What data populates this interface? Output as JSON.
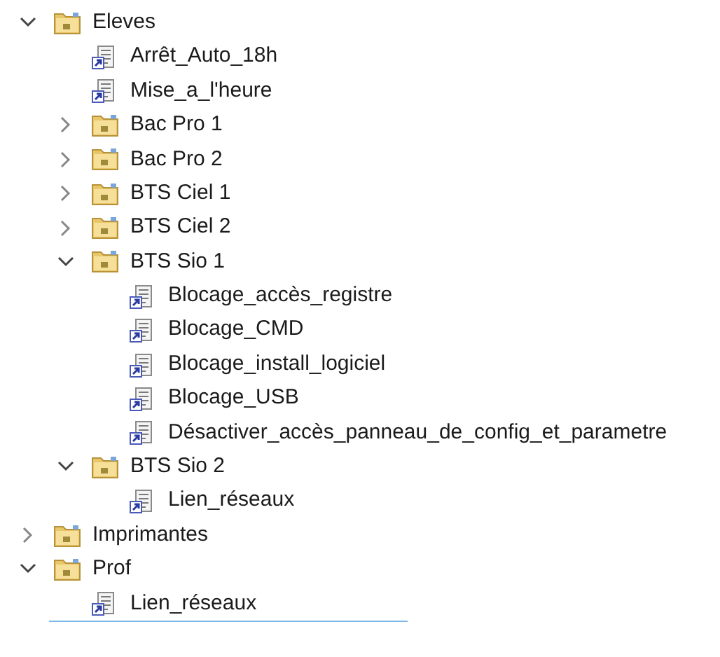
{
  "tree": [
    {
      "label": "Eleves",
      "kind": "folder",
      "expanded": true,
      "children": [
        {
          "label": "Arrêt_Auto_18h",
          "kind": "link"
        },
        {
          "label": "Mise_a_l'heure",
          "kind": "link"
        },
        {
          "label": "Bac Pro 1",
          "kind": "folder",
          "expanded": false
        },
        {
          "label": "Bac Pro 2",
          "kind": "folder",
          "expanded": false
        },
        {
          "label": "BTS Ciel 1",
          "kind": "folder",
          "expanded": false
        },
        {
          "label": "BTS Ciel 2",
          "kind": "folder",
          "expanded": false
        },
        {
          "label": "BTS Sio 1",
          "kind": "folder",
          "expanded": true,
          "children": [
            {
              "label": "Blocage_accès_registre",
              "kind": "link"
            },
            {
              "label": "Blocage_CMD",
              "kind": "link"
            },
            {
              "label": "Blocage_install_logiciel",
              "kind": "link"
            },
            {
              "label": "Blocage_USB",
              "kind": "link"
            },
            {
              "label": "Désactiver_accès_panneau_de_config_et_parametre",
              "kind": "link"
            }
          ]
        },
        {
          "label": "BTS Sio 2",
          "kind": "folder",
          "expanded": true,
          "children": [
            {
              "label": "Lien_réseaux",
              "kind": "link"
            }
          ]
        }
      ]
    },
    {
      "label": "Imprimantes",
      "kind": "folder",
      "expanded": false
    },
    {
      "label": "Prof",
      "kind": "folder",
      "expanded": true,
      "children": [
        {
          "label": "Lien_réseaux",
          "kind": "link"
        }
      ]
    }
  ]
}
